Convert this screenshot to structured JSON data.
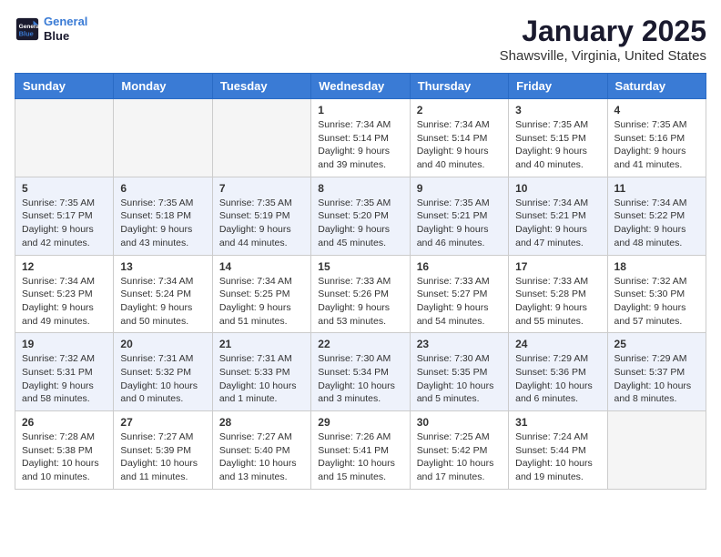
{
  "header": {
    "logo_line1": "General",
    "logo_line2": "Blue",
    "title": "January 2025",
    "subtitle": "Shawsville, Virginia, United States"
  },
  "weekdays": [
    "Sunday",
    "Monday",
    "Tuesday",
    "Wednesday",
    "Thursday",
    "Friday",
    "Saturday"
  ],
  "weeks": [
    [
      {
        "day": "",
        "info": ""
      },
      {
        "day": "",
        "info": ""
      },
      {
        "day": "",
        "info": ""
      },
      {
        "day": "1",
        "info": "Sunrise: 7:34 AM\nSunset: 5:14 PM\nDaylight: 9 hours\nand 39 minutes."
      },
      {
        "day": "2",
        "info": "Sunrise: 7:34 AM\nSunset: 5:14 PM\nDaylight: 9 hours\nand 40 minutes."
      },
      {
        "day": "3",
        "info": "Sunrise: 7:35 AM\nSunset: 5:15 PM\nDaylight: 9 hours\nand 40 minutes."
      },
      {
        "day": "4",
        "info": "Sunrise: 7:35 AM\nSunset: 5:16 PM\nDaylight: 9 hours\nand 41 minutes."
      }
    ],
    [
      {
        "day": "5",
        "info": "Sunrise: 7:35 AM\nSunset: 5:17 PM\nDaylight: 9 hours\nand 42 minutes."
      },
      {
        "day": "6",
        "info": "Sunrise: 7:35 AM\nSunset: 5:18 PM\nDaylight: 9 hours\nand 43 minutes."
      },
      {
        "day": "7",
        "info": "Sunrise: 7:35 AM\nSunset: 5:19 PM\nDaylight: 9 hours\nand 44 minutes."
      },
      {
        "day": "8",
        "info": "Sunrise: 7:35 AM\nSunset: 5:20 PM\nDaylight: 9 hours\nand 45 minutes."
      },
      {
        "day": "9",
        "info": "Sunrise: 7:35 AM\nSunset: 5:21 PM\nDaylight: 9 hours\nand 46 minutes."
      },
      {
        "day": "10",
        "info": "Sunrise: 7:34 AM\nSunset: 5:21 PM\nDaylight: 9 hours\nand 47 minutes."
      },
      {
        "day": "11",
        "info": "Sunrise: 7:34 AM\nSunset: 5:22 PM\nDaylight: 9 hours\nand 48 minutes."
      }
    ],
    [
      {
        "day": "12",
        "info": "Sunrise: 7:34 AM\nSunset: 5:23 PM\nDaylight: 9 hours\nand 49 minutes."
      },
      {
        "day": "13",
        "info": "Sunrise: 7:34 AM\nSunset: 5:24 PM\nDaylight: 9 hours\nand 50 minutes."
      },
      {
        "day": "14",
        "info": "Sunrise: 7:34 AM\nSunset: 5:25 PM\nDaylight: 9 hours\nand 51 minutes."
      },
      {
        "day": "15",
        "info": "Sunrise: 7:33 AM\nSunset: 5:26 PM\nDaylight: 9 hours\nand 53 minutes."
      },
      {
        "day": "16",
        "info": "Sunrise: 7:33 AM\nSunset: 5:27 PM\nDaylight: 9 hours\nand 54 minutes."
      },
      {
        "day": "17",
        "info": "Sunrise: 7:33 AM\nSunset: 5:28 PM\nDaylight: 9 hours\nand 55 minutes."
      },
      {
        "day": "18",
        "info": "Sunrise: 7:32 AM\nSunset: 5:30 PM\nDaylight: 9 hours\nand 57 minutes."
      }
    ],
    [
      {
        "day": "19",
        "info": "Sunrise: 7:32 AM\nSunset: 5:31 PM\nDaylight: 9 hours\nand 58 minutes."
      },
      {
        "day": "20",
        "info": "Sunrise: 7:31 AM\nSunset: 5:32 PM\nDaylight: 10 hours\nand 0 minutes."
      },
      {
        "day": "21",
        "info": "Sunrise: 7:31 AM\nSunset: 5:33 PM\nDaylight: 10 hours\nand 1 minute."
      },
      {
        "day": "22",
        "info": "Sunrise: 7:30 AM\nSunset: 5:34 PM\nDaylight: 10 hours\nand 3 minutes."
      },
      {
        "day": "23",
        "info": "Sunrise: 7:30 AM\nSunset: 5:35 PM\nDaylight: 10 hours\nand 5 minutes."
      },
      {
        "day": "24",
        "info": "Sunrise: 7:29 AM\nSunset: 5:36 PM\nDaylight: 10 hours\nand 6 minutes."
      },
      {
        "day": "25",
        "info": "Sunrise: 7:29 AM\nSunset: 5:37 PM\nDaylight: 10 hours\nand 8 minutes."
      }
    ],
    [
      {
        "day": "26",
        "info": "Sunrise: 7:28 AM\nSunset: 5:38 PM\nDaylight: 10 hours\nand 10 minutes."
      },
      {
        "day": "27",
        "info": "Sunrise: 7:27 AM\nSunset: 5:39 PM\nDaylight: 10 hours\nand 11 minutes."
      },
      {
        "day": "28",
        "info": "Sunrise: 7:27 AM\nSunset: 5:40 PM\nDaylight: 10 hours\nand 13 minutes."
      },
      {
        "day": "29",
        "info": "Sunrise: 7:26 AM\nSunset: 5:41 PM\nDaylight: 10 hours\nand 15 minutes."
      },
      {
        "day": "30",
        "info": "Sunrise: 7:25 AM\nSunset: 5:42 PM\nDaylight: 10 hours\nand 17 minutes."
      },
      {
        "day": "31",
        "info": "Sunrise: 7:24 AM\nSunset: 5:44 PM\nDaylight: 10 hours\nand 19 minutes."
      },
      {
        "day": "",
        "info": ""
      }
    ]
  ]
}
